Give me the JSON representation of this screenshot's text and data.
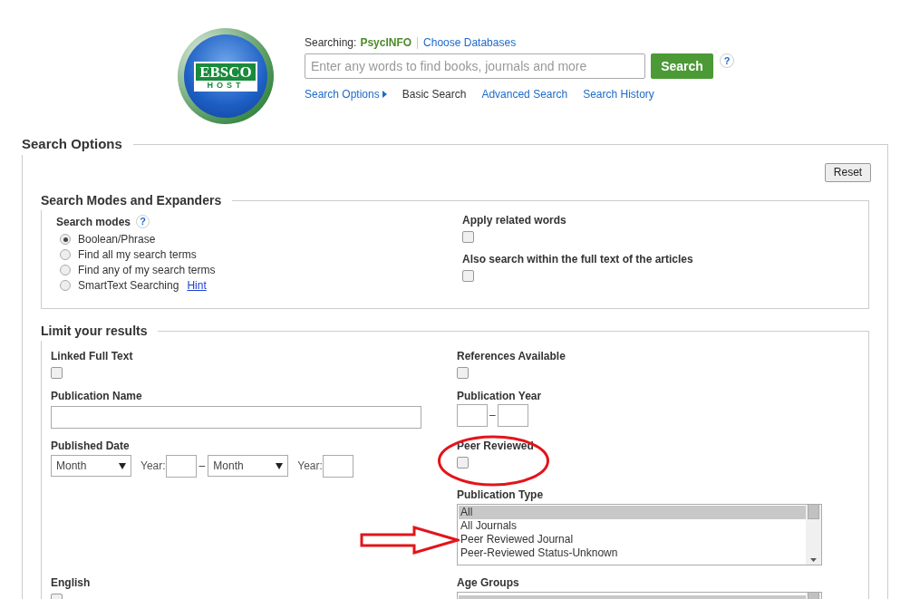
{
  "header": {
    "logo": {
      "top": "EBSCO",
      "bottom": "HOST"
    },
    "searching_label": "Searching:",
    "database": "PsycINFO",
    "choose_link": "Choose Databases",
    "search_placeholder": "Enter any words to find books, journals and more",
    "search_button": "Search",
    "help": "?",
    "nav": [
      {
        "label": "Search Options",
        "kind": "dropdown",
        "selected": false
      },
      {
        "label": "Basic Search",
        "kind": "link",
        "selected": true
      },
      {
        "label": "Advanced Search",
        "kind": "link",
        "selected": false
      },
      {
        "label": "Search History",
        "kind": "link",
        "selected": false
      }
    ]
  },
  "search_options": {
    "title": "Search Options",
    "reset": "Reset",
    "modes": {
      "title": "Search Modes and Expanders",
      "modes_label": "Search modes",
      "help": "?",
      "hint": "Hint",
      "options": [
        {
          "label": "Boolean/Phrase",
          "selected": true
        },
        {
          "label": "Find all my search terms",
          "selected": false
        },
        {
          "label": "Find any of my search terms",
          "selected": false
        },
        {
          "label": "SmartText Searching",
          "selected": false
        }
      ],
      "expanders": [
        {
          "label": "Apply related words",
          "checked": false
        },
        {
          "label": "Also search within the full text of the articles",
          "checked": false
        }
      ]
    },
    "limits": {
      "title": "Limit your results",
      "rows": [
        {
          "left": {
            "kind": "checkbox",
            "label": "Linked Full Text",
            "checked": false
          },
          "right": {
            "kind": "checkbox",
            "label": "References Available",
            "checked": false
          }
        },
        {
          "left": {
            "kind": "text",
            "label": "Publication Name"
          },
          "right": {
            "kind": "year_range",
            "label": "Publication Year",
            "dash": "–"
          }
        },
        {
          "left": {
            "kind": "date_range",
            "label": "Published Date",
            "from_month": "Month",
            "from_year_label": "Year:",
            "dash": "–",
            "to_month": "Month",
            "to_year_label": "Year:"
          },
          "right": {
            "kind": "checkbox",
            "label": "Peer Reviewed",
            "checked": false
          }
        },
        {
          "right": {
            "kind": "listbox",
            "label": "Publication Type",
            "options": [
              {
                "label": "All",
                "selected": true
              },
              {
                "label": "All Journals",
                "selected": false
              },
              {
                "label": "Peer Reviewed Journal",
                "selected": false
              },
              {
                "label": "Peer-Reviewed Status-Unknown",
                "selected": false
              }
            ]
          }
        },
        {
          "left": {
            "kind": "checkbox",
            "label": "English",
            "checked": false
          },
          "right": {
            "kind": "listbox",
            "label": "Age Groups"
          }
        }
      ]
    }
  }
}
